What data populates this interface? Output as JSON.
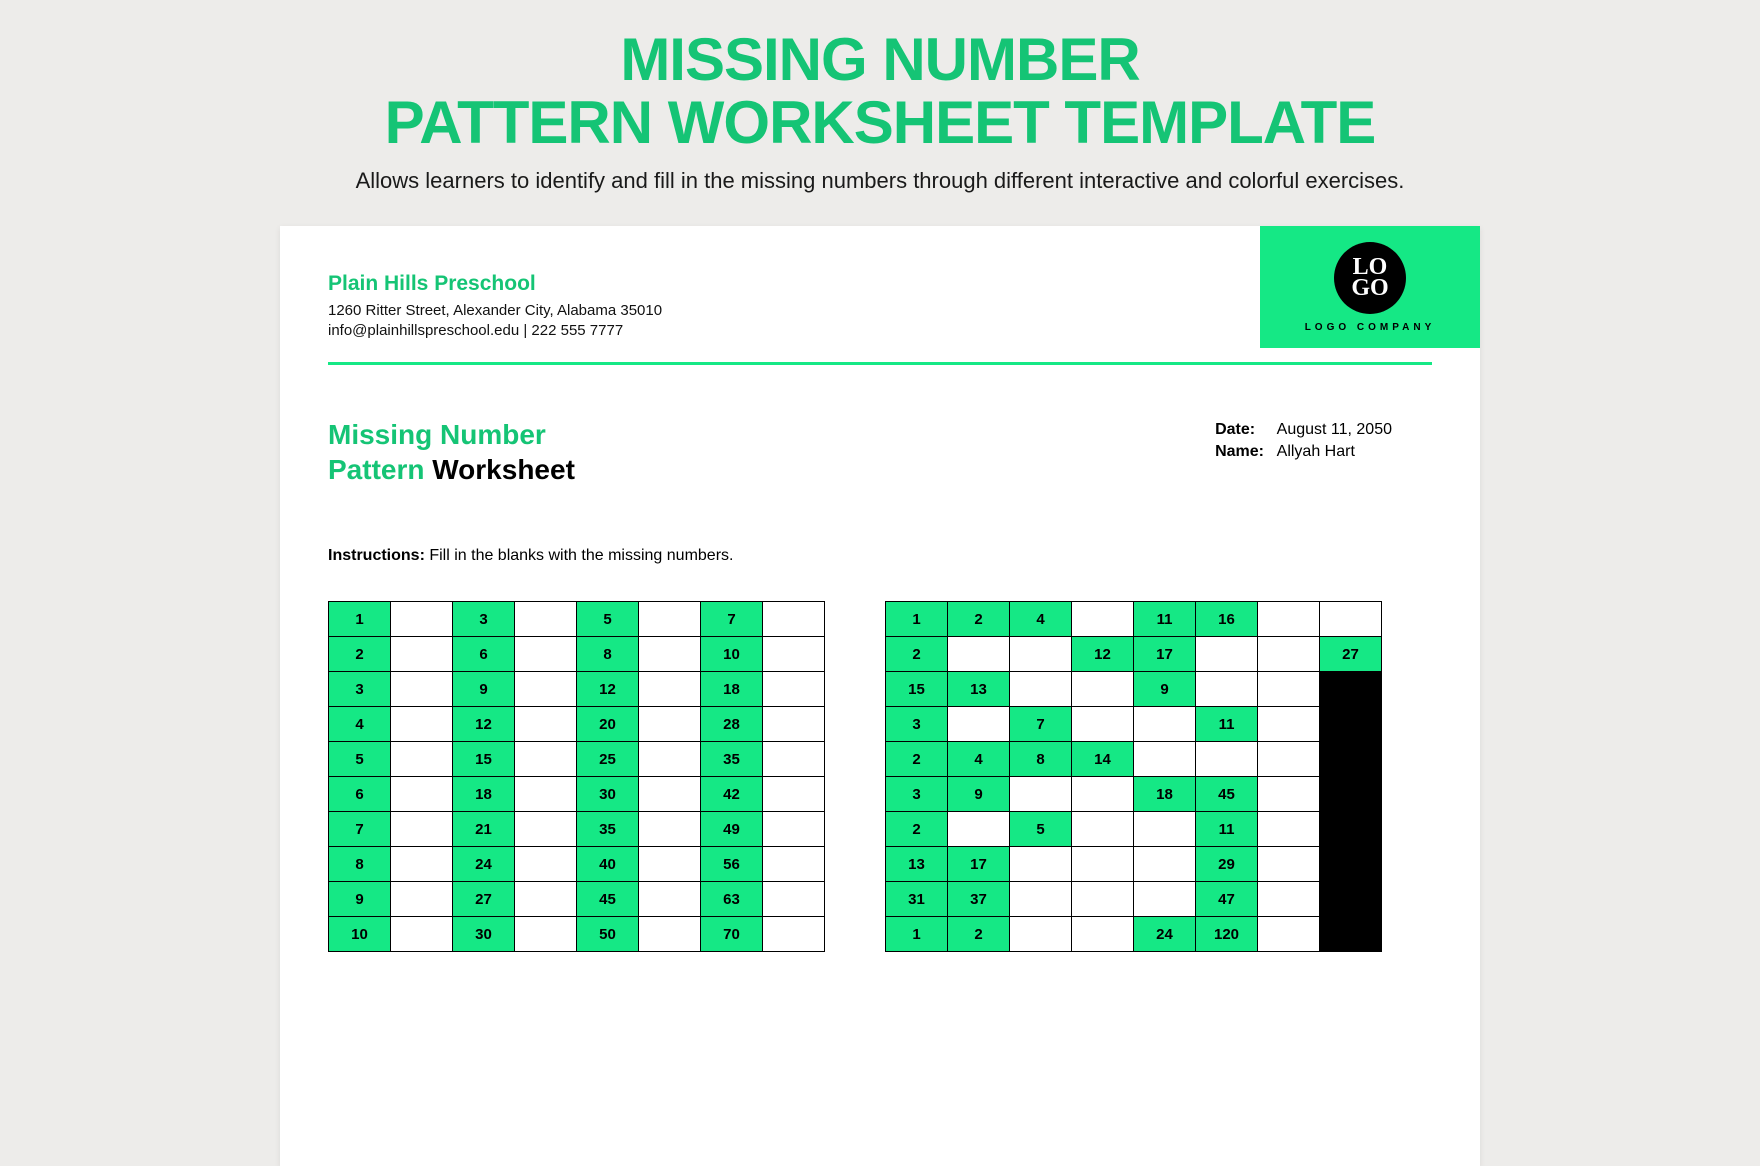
{
  "page": {
    "title_line1": "MISSING NUMBER",
    "title_line2": "PATTERN WORKSHEET TEMPLATE",
    "subtitle": "Allows learners to identify and fill in the missing numbers through different interactive and colorful exercises."
  },
  "org": {
    "name": "Plain Hills Preschool",
    "address": "1260 Ritter Street, Alexander City, Alabama 35010",
    "contact": "info@plainhillspreschool.edu | 222 555 7777"
  },
  "logo": {
    "line1": "LO",
    "line2": "GO",
    "caption": "LOGO COMPANY"
  },
  "worksheet": {
    "title_green1": "Missing Number",
    "title_green2": "Pattern",
    "title_black": " Worksheet",
    "date_label": "Date:",
    "date_value": "August 11, 2050",
    "name_label": "Name:",
    "name_value": "Allyah Hart",
    "instructions_label": "Instructions:",
    "instructions_text": "  Fill in the blanks with the missing numbers."
  },
  "grid_left": [
    [
      {
        "v": "1",
        "f": true
      },
      {
        "v": "",
        "f": false
      },
      {
        "v": "3",
        "f": true
      },
      {
        "v": "",
        "f": false
      },
      {
        "v": "5",
        "f": true
      },
      {
        "v": "",
        "f": false
      },
      {
        "v": "7",
        "f": true
      },
      {
        "v": "",
        "f": false
      }
    ],
    [
      {
        "v": "2",
        "f": true
      },
      {
        "v": "",
        "f": false
      },
      {
        "v": "6",
        "f": true
      },
      {
        "v": "",
        "f": false
      },
      {
        "v": "8",
        "f": true
      },
      {
        "v": "",
        "f": false
      },
      {
        "v": "10",
        "f": true
      },
      {
        "v": "",
        "f": false
      }
    ],
    [
      {
        "v": "3",
        "f": true
      },
      {
        "v": "",
        "f": false
      },
      {
        "v": "9",
        "f": true
      },
      {
        "v": "",
        "f": false
      },
      {
        "v": "12",
        "f": true
      },
      {
        "v": "",
        "f": false
      },
      {
        "v": "18",
        "f": true
      },
      {
        "v": "",
        "f": false
      }
    ],
    [
      {
        "v": "4",
        "f": true
      },
      {
        "v": "",
        "f": false
      },
      {
        "v": "12",
        "f": true
      },
      {
        "v": "",
        "f": false
      },
      {
        "v": "20",
        "f": true
      },
      {
        "v": "",
        "f": false
      },
      {
        "v": "28",
        "f": true
      },
      {
        "v": "",
        "f": false
      }
    ],
    [
      {
        "v": "5",
        "f": true
      },
      {
        "v": "",
        "f": false
      },
      {
        "v": "15",
        "f": true
      },
      {
        "v": "",
        "f": false
      },
      {
        "v": "25",
        "f": true
      },
      {
        "v": "",
        "f": false
      },
      {
        "v": "35",
        "f": true
      },
      {
        "v": "",
        "f": false
      }
    ],
    [
      {
        "v": "6",
        "f": true
      },
      {
        "v": "",
        "f": false
      },
      {
        "v": "18",
        "f": true
      },
      {
        "v": "",
        "f": false
      },
      {
        "v": "30",
        "f": true
      },
      {
        "v": "",
        "f": false
      },
      {
        "v": "42",
        "f": true
      },
      {
        "v": "",
        "f": false
      }
    ],
    [
      {
        "v": "7",
        "f": true
      },
      {
        "v": "",
        "f": false
      },
      {
        "v": "21",
        "f": true
      },
      {
        "v": "",
        "f": false
      },
      {
        "v": "35",
        "f": true
      },
      {
        "v": "",
        "f": false
      },
      {
        "v": "49",
        "f": true
      },
      {
        "v": "",
        "f": false
      }
    ],
    [
      {
        "v": "8",
        "f": true
      },
      {
        "v": "",
        "f": false
      },
      {
        "v": "24",
        "f": true
      },
      {
        "v": "",
        "f": false
      },
      {
        "v": "40",
        "f": true
      },
      {
        "v": "",
        "f": false
      },
      {
        "v": "56",
        "f": true
      },
      {
        "v": "",
        "f": false
      }
    ],
    [
      {
        "v": "9",
        "f": true
      },
      {
        "v": "",
        "f": false
      },
      {
        "v": "27",
        "f": true
      },
      {
        "v": "",
        "f": false
      },
      {
        "v": "45",
        "f": true
      },
      {
        "v": "",
        "f": false
      },
      {
        "v": "63",
        "f": true
      },
      {
        "v": "",
        "f": false
      }
    ],
    [
      {
        "v": "10",
        "f": true
      },
      {
        "v": "",
        "f": false
      },
      {
        "v": "30",
        "f": true
      },
      {
        "v": "",
        "f": false
      },
      {
        "v": "50",
        "f": true
      },
      {
        "v": "",
        "f": false
      },
      {
        "v": "70",
        "f": true
      },
      {
        "v": "",
        "f": false
      }
    ]
  ],
  "grid_right": [
    [
      {
        "v": "1",
        "f": true
      },
      {
        "v": "2",
        "f": true
      },
      {
        "v": "4",
        "f": true
      },
      {
        "v": "",
        "f": false
      },
      {
        "v": "11",
        "f": true
      },
      {
        "v": "16",
        "f": true
      },
      {
        "v": "",
        "f": false
      },
      {
        "v": "",
        "f": false
      }
    ],
    [
      {
        "v": "2",
        "f": true
      },
      {
        "v": "",
        "f": false
      },
      {
        "v": "",
        "f": false
      },
      {
        "v": "12",
        "f": true
      },
      {
        "v": "17",
        "f": true
      },
      {
        "v": "",
        "f": false
      },
      {
        "v": "",
        "f": false
      },
      {
        "v": "27",
        "f": true
      }
    ],
    [
      {
        "v": "15",
        "f": true
      },
      {
        "v": "13",
        "f": true
      },
      {
        "v": "",
        "f": false
      },
      {
        "v": "",
        "f": false
      },
      {
        "v": "9",
        "f": true
      },
      {
        "v": "",
        "f": false
      },
      {
        "v": "",
        "f": false
      },
      {
        "v": "",
        "k": true
      }
    ],
    [
      {
        "v": "3",
        "f": true
      },
      {
        "v": "",
        "f": false
      },
      {
        "v": "7",
        "f": true
      },
      {
        "v": "",
        "f": false
      },
      {
        "v": "",
        "f": false
      },
      {
        "v": "11",
        "f": true
      },
      {
        "v": "",
        "f": false
      },
      {
        "v": "",
        "k": true
      }
    ],
    [
      {
        "v": "2",
        "f": true
      },
      {
        "v": "4",
        "f": true
      },
      {
        "v": "8",
        "f": true
      },
      {
        "v": "14",
        "f": true
      },
      {
        "v": "",
        "f": false
      },
      {
        "v": "",
        "f": false
      },
      {
        "v": "",
        "f": false
      },
      {
        "v": "",
        "k": true
      }
    ],
    [
      {
        "v": "3",
        "f": true
      },
      {
        "v": "9",
        "f": true
      },
      {
        "v": "",
        "f": false
      },
      {
        "v": "",
        "f": false
      },
      {
        "v": "18",
        "f": true
      },
      {
        "v": "45",
        "f": true
      },
      {
        "v": "",
        "f": false
      },
      {
        "v": "",
        "k": true
      }
    ],
    [
      {
        "v": "2",
        "f": true
      },
      {
        "v": "",
        "f": false
      },
      {
        "v": "5",
        "f": true
      },
      {
        "v": "",
        "f": false
      },
      {
        "v": "",
        "f": false
      },
      {
        "v": "11",
        "f": true
      },
      {
        "v": "",
        "f": false
      },
      {
        "v": "",
        "k": true
      }
    ],
    [
      {
        "v": "13",
        "f": true
      },
      {
        "v": "17",
        "f": true
      },
      {
        "v": "",
        "f": false
      },
      {
        "v": "",
        "f": false
      },
      {
        "v": "",
        "f": false
      },
      {
        "v": "29",
        "f": true
      },
      {
        "v": "",
        "f": false
      },
      {
        "v": "",
        "k": true
      }
    ],
    [
      {
        "v": "31",
        "f": true
      },
      {
        "v": "37",
        "f": true
      },
      {
        "v": "",
        "f": false
      },
      {
        "v": "",
        "f": false
      },
      {
        "v": "",
        "f": false
      },
      {
        "v": "47",
        "f": true
      },
      {
        "v": "",
        "f": false
      },
      {
        "v": "",
        "k": true
      }
    ],
    [
      {
        "v": "1",
        "f": true
      },
      {
        "v": "2",
        "f": true
      },
      {
        "v": "",
        "f": false
      },
      {
        "v": "",
        "f": false
      },
      {
        "v": "24",
        "f": true
      },
      {
        "v": "120",
        "f": true
      },
      {
        "v": "",
        "f": false
      },
      {
        "v": "",
        "k": true
      }
    ]
  ]
}
